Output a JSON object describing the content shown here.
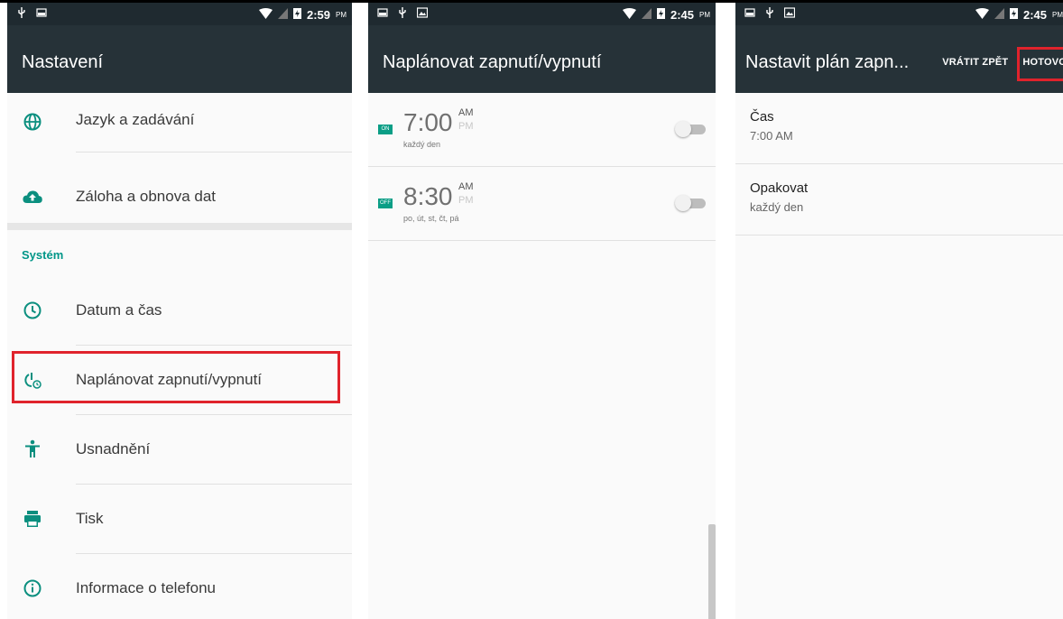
{
  "panel1": {
    "status": {
      "time": "2:59",
      "ampm": "PM"
    },
    "title": "Nastavení",
    "items_top": [
      {
        "label": "Jazyk a zadávání"
      },
      {
        "label": "Záloha a obnova dat"
      }
    ],
    "section": "Systém",
    "items": [
      {
        "label": "Datum a čas"
      },
      {
        "label": "Naplánovat zapnutí/vypnutí"
      },
      {
        "label": "Usnadnění"
      },
      {
        "label": "Tisk"
      },
      {
        "label": "Informace o telefonu"
      }
    ]
  },
  "panel2": {
    "status": {
      "time": "2:45",
      "ampm": "PM"
    },
    "title": "Naplánovat zapnutí/vypnutí",
    "schedules": [
      {
        "badge": "ON",
        "time": "7:00",
        "am": "AM",
        "pm": "PM",
        "days": "každý den"
      },
      {
        "badge": "OFF",
        "time": "8:30",
        "am": "AM",
        "pm": "PM",
        "days": "po, út, st, čt, pá"
      }
    ]
  },
  "panel3": {
    "status": {
      "time": "2:45",
      "ampm": "PM"
    },
    "title": "Nastavit plán zapn...",
    "undo": "VRÁTIT ZPĚT",
    "done": "HOTOVO",
    "prefs": [
      {
        "title": "Čas",
        "summary": "7:00 AM"
      },
      {
        "title": "Opakovat",
        "summary": "každý den"
      }
    ]
  },
  "colors": {
    "appbar": "#263238",
    "statusbar": "#1f2a30",
    "accent": "#009688",
    "highlight": "#e0232c"
  }
}
